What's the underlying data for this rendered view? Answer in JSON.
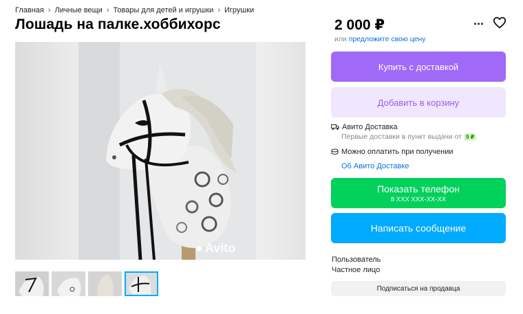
{
  "breadcrumb": [
    {
      "label": "Главная"
    },
    {
      "label": "Личные вещи"
    },
    {
      "label": "Товары для детей и игрушки"
    },
    {
      "label": "Игрушки"
    }
  ],
  "title": "Лошадь на палке.хоббихорс",
  "gallery": {
    "watermark": "Avito",
    "thumb_count": 4,
    "active_thumb": 4
  },
  "price": "2 000 ₽",
  "offer": {
    "prefix": "или",
    "link": "предложите свою цену"
  },
  "buttons": {
    "buy": "Купить с доставкой",
    "cart": "Добавить в корзину",
    "phone": "Показать телефон",
    "phone_sub": "8 XXX XXX-XX-XX",
    "message": "Написать сообщение",
    "subscribe": "Подписаться на продавца"
  },
  "delivery": {
    "title": "Авито Доставка",
    "note": "Первые доставки в пункт выдачи от",
    "badge": "9 ₽",
    "pay": "Можно оплатить при получении",
    "about_link": "Об Авито Доставке"
  },
  "seller": {
    "type": "Пользователь",
    "kind": "Частное лицо"
  },
  "icons": {
    "more": "more-dots-icon",
    "favorite": "heart-icon",
    "truck": "truck-icon",
    "wallet": "wallet-icon"
  },
  "colors": {
    "buy": "#a169f7",
    "cart": "#f0e6fd",
    "phone": "#02d15c",
    "message": "#00aaff",
    "link": "#0a6ddc"
  }
}
